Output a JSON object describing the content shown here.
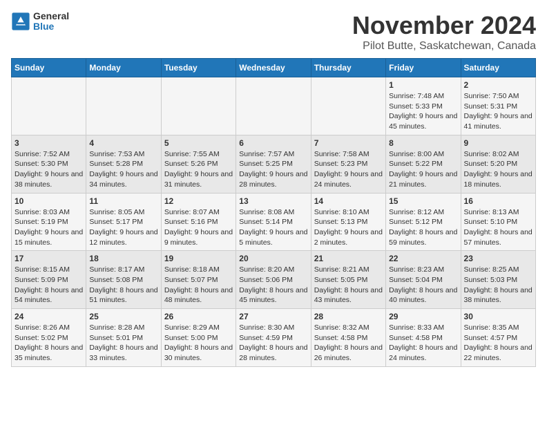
{
  "logo": {
    "general": "General",
    "blue": "Blue"
  },
  "title": "November 2024",
  "location": "Pilot Butte, Saskatchewan, Canada",
  "headers": [
    "Sunday",
    "Monday",
    "Tuesday",
    "Wednesday",
    "Thursday",
    "Friday",
    "Saturday"
  ],
  "weeks": [
    [
      {
        "day": "",
        "info": ""
      },
      {
        "day": "",
        "info": ""
      },
      {
        "day": "",
        "info": ""
      },
      {
        "day": "",
        "info": ""
      },
      {
        "day": "",
        "info": ""
      },
      {
        "day": "1",
        "info": "Sunrise: 7:48 AM\nSunset: 5:33 PM\nDaylight: 9 hours and 45 minutes."
      },
      {
        "day": "2",
        "info": "Sunrise: 7:50 AM\nSunset: 5:31 PM\nDaylight: 9 hours and 41 minutes."
      }
    ],
    [
      {
        "day": "3",
        "info": "Sunrise: 7:52 AM\nSunset: 5:30 PM\nDaylight: 9 hours and 38 minutes."
      },
      {
        "day": "4",
        "info": "Sunrise: 7:53 AM\nSunset: 5:28 PM\nDaylight: 9 hours and 34 minutes."
      },
      {
        "day": "5",
        "info": "Sunrise: 7:55 AM\nSunset: 5:26 PM\nDaylight: 9 hours and 31 minutes."
      },
      {
        "day": "6",
        "info": "Sunrise: 7:57 AM\nSunset: 5:25 PM\nDaylight: 9 hours and 28 minutes."
      },
      {
        "day": "7",
        "info": "Sunrise: 7:58 AM\nSunset: 5:23 PM\nDaylight: 9 hours and 24 minutes."
      },
      {
        "day": "8",
        "info": "Sunrise: 8:00 AM\nSunset: 5:22 PM\nDaylight: 9 hours and 21 minutes."
      },
      {
        "day": "9",
        "info": "Sunrise: 8:02 AM\nSunset: 5:20 PM\nDaylight: 9 hours and 18 minutes."
      }
    ],
    [
      {
        "day": "10",
        "info": "Sunrise: 8:03 AM\nSunset: 5:19 PM\nDaylight: 9 hours and 15 minutes."
      },
      {
        "day": "11",
        "info": "Sunrise: 8:05 AM\nSunset: 5:17 PM\nDaylight: 9 hours and 12 minutes."
      },
      {
        "day": "12",
        "info": "Sunrise: 8:07 AM\nSunset: 5:16 PM\nDaylight: 9 hours and 9 minutes."
      },
      {
        "day": "13",
        "info": "Sunrise: 8:08 AM\nSunset: 5:14 PM\nDaylight: 9 hours and 5 minutes."
      },
      {
        "day": "14",
        "info": "Sunrise: 8:10 AM\nSunset: 5:13 PM\nDaylight: 9 hours and 2 minutes."
      },
      {
        "day": "15",
        "info": "Sunrise: 8:12 AM\nSunset: 5:12 PM\nDaylight: 8 hours and 59 minutes."
      },
      {
        "day": "16",
        "info": "Sunrise: 8:13 AM\nSunset: 5:10 PM\nDaylight: 8 hours and 57 minutes."
      }
    ],
    [
      {
        "day": "17",
        "info": "Sunrise: 8:15 AM\nSunset: 5:09 PM\nDaylight: 8 hours and 54 minutes."
      },
      {
        "day": "18",
        "info": "Sunrise: 8:17 AM\nSunset: 5:08 PM\nDaylight: 8 hours and 51 minutes."
      },
      {
        "day": "19",
        "info": "Sunrise: 8:18 AM\nSunset: 5:07 PM\nDaylight: 8 hours and 48 minutes."
      },
      {
        "day": "20",
        "info": "Sunrise: 8:20 AM\nSunset: 5:06 PM\nDaylight: 8 hours and 45 minutes."
      },
      {
        "day": "21",
        "info": "Sunrise: 8:21 AM\nSunset: 5:05 PM\nDaylight: 8 hours and 43 minutes."
      },
      {
        "day": "22",
        "info": "Sunrise: 8:23 AM\nSunset: 5:04 PM\nDaylight: 8 hours and 40 minutes."
      },
      {
        "day": "23",
        "info": "Sunrise: 8:25 AM\nSunset: 5:03 PM\nDaylight: 8 hours and 38 minutes."
      }
    ],
    [
      {
        "day": "24",
        "info": "Sunrise: 8:26 AM\nSunset: 5:02 PM\nDaylight: 8 hours and 35 minutes."
      },
      {
        "day": "25",
        "info": "Sunrise: 8:28 AM\nSunset: 5:01 PM\nDaylight: 8 hours and 33 minutes."
      },
      {
        "day": "26",
        "info": "Sunrise: 8:29 AM\nSunset: 5:00 PM\nDaylight: 8 hours and 30 minutes."
      },
      {
        "day": "27",
        "info": "Sunrise: 8:30 AM\nSunset: 4:59 PM\nDaylight: 8 hours and 28 minutes."
      },
      {
        "day": "28",
        "info": "Sunrise: 8:32 AM\nSunset: 4:58 PM\nDaylight: 8 hours and 26 minutes."
      },
      {
        "day": "29",
        "info": "Sunrise: 8:33 AM\nSunset: 4:58 PM\nDaylight: 8 hours and 24 minutes."
      },
      {
        "day": "30",
        "info": "Sunrise: 8:35 AM\nSunset: 4:57 PM\nDaylight: 8 hours and 22 minutes."
      }
    ]
  ]
}
